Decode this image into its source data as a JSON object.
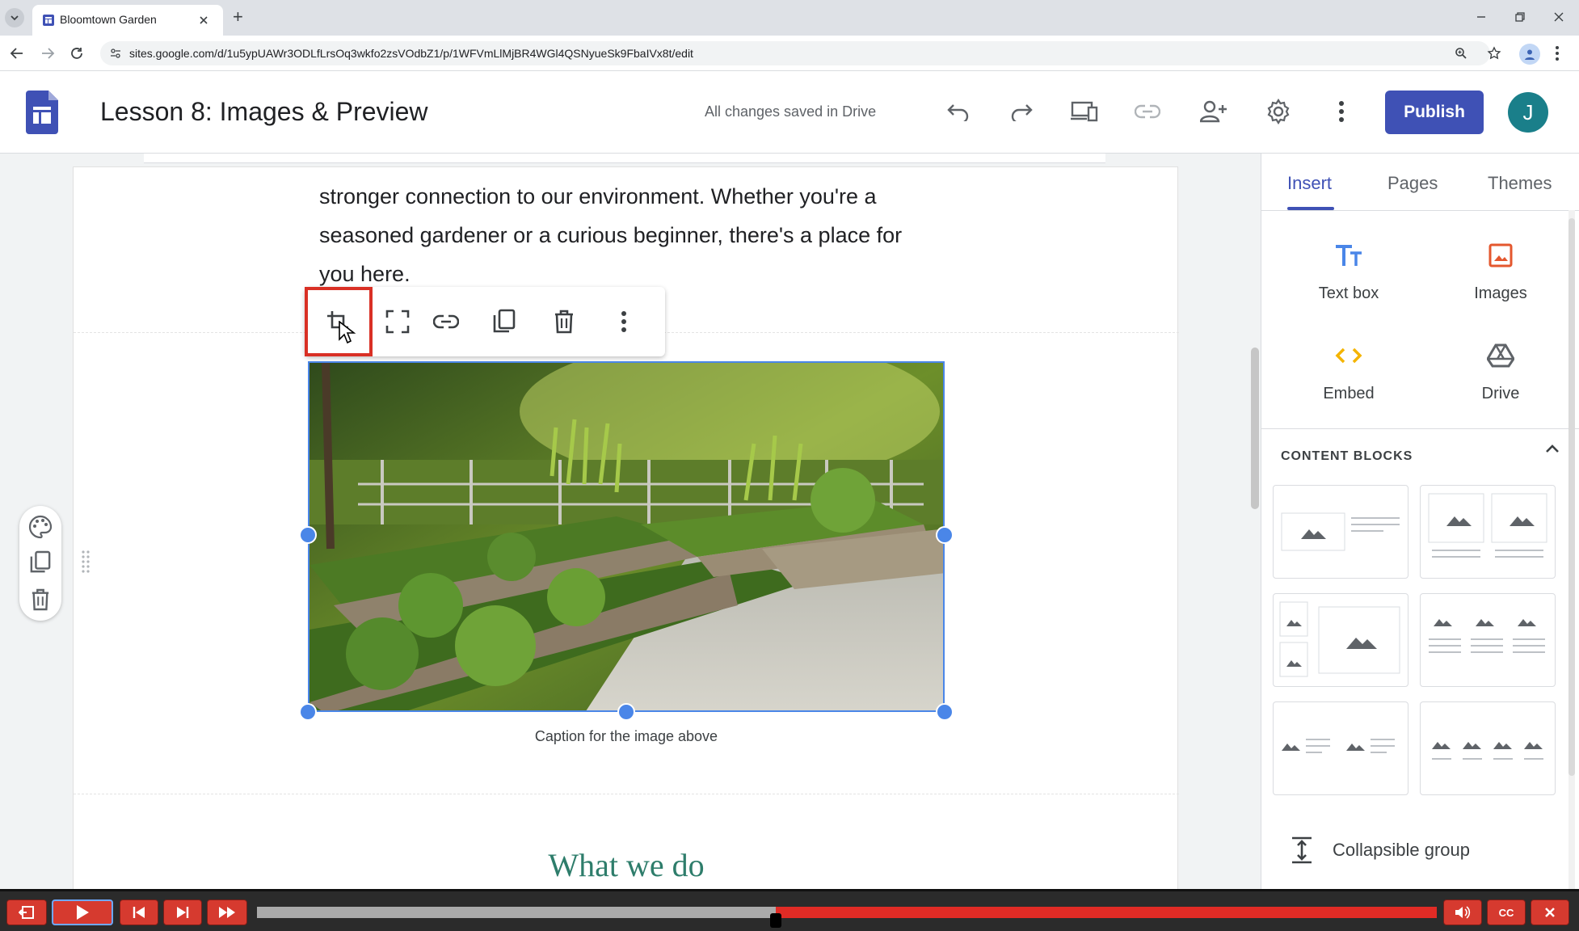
{
  "browser": {
    "tab_title": "Bloomtown Garden",
    "new_tab_symbol": "+",
    "url": "sites.google.com/d/1u5ypUAWr3ODLfLrsOq3wkfo2zsVOdbZ1/p/1WFVmLlMjBR4WGl4QSNyueSk9FbaIVx8t/edit"
  },
  "header": {
    "title": "Lesson 8: Images & Preview",
    "save_status": "All changes saved in Drive",
    "publish_label": "Publish",
    "avatar_letter": "J"
  },
  "page": {
    "body_text": "stronger connection to our environment. Whether you're a seasoned gardener or a curious beginner, there's a place for you here.",
    "caption": "Caption for the image above",
    "section_heading": "What we do"
  },
  "panel": {
    "tabs": [
      "Insert",
      "Pages",
      "Themes"
    ],
    "active_tab": "Insert",
    "insert_items": [
      "Text box",
      "Images",
      "Embed",
      "Drive"
    ],
    "content_blocks_title": "CONTENT BLOCKS",
    "collapsible_label": "Collapsible group"
  },
  "player": {
    "progress": 0.44,
    "buttons": [
      "exit",
      "play",
      "previous",
      "next",
      "fast-forward",
      "volume",
      "CC",
      "close"
    ],
    "cc_label": "CC"
  },
  "colors": {
    "accent": "#3f51b5",
    "avatar": "#1a7f8a",
    "heading": "#2e7d6b",
    "selection": "#4a86e8",
    "highlight": "#d93025",
    "player_red": "#d63a2f"
  }
}
